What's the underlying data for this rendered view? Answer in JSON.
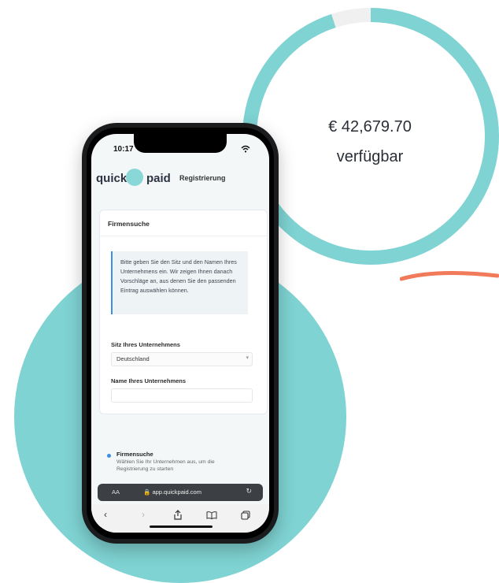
{
  "balance": {
    "amount": "€ 42,679.70",
    "label": "verfügbar",
    "progress_fraction": 0.95,
    "ring_color": "#7fd3d3",
    "track_color": "#f0f0f0"
  },
  "status_bar": {
    "time": "10:17"
  },
  "app": {
    "logo_left": "quick",
    "logo_right": "paid",
    "header_link": "Registrierung"
  },
  "card": {
    "title": "Firmensuche",
    "info_text": "Bitte geben Sie den Sitz und den Namen Ihres Unternehmens ein. Wir zeigen Ihnen danach Vorschläge an, aus denen Sie den passenden Eintrag auswählen können.",
    "seat_label": "Sitz Ihres Unternehmens",
    "seat_value": "Deutschland",
    "name_label": "Name Ihres Unternehmens",
    "name_value": ""
  },
  "steps": [
    {
      "title": "Firmensuche",
      "desc": "Wählen Sie Ihr Unternehmen aus, um die Registrierung zu starten"
    }
  ],
  "browser": {
    "aa": "AA",
    "url": "app.quickpaid.com",
    "back": "‹",
    "forward": "›"
  },
  "colors": {
    "accent": "#7fd3d3",
    "link_blue": "#3a8ee6",
    "brand_orange": "#f07a5a"
  }
}
